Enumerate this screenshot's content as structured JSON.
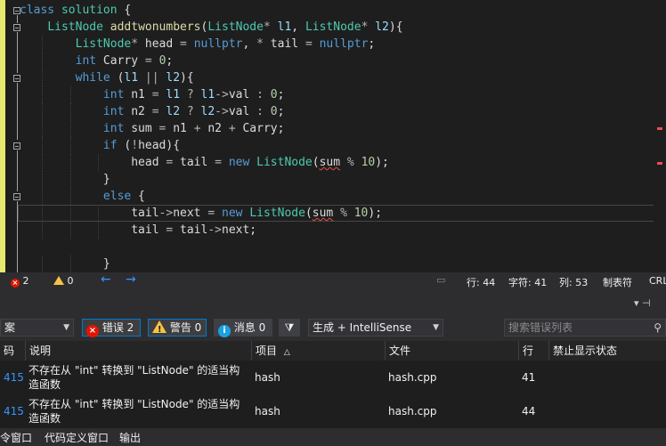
{
  "editor": {
    "lines": [
      [
        [
          "kw",
          "class"
        ],
        [
          "tx",
          " "
        ],
        [
          "ty",
          "solution"
        ],
        [
          "tx",
          " {"
        ]
      ],
      [
        [
          "tx",
          "    "
        ],
        [
          "ty",
          "ListNode"
        ],
        [
          "tx",
          " "
        ],
        [
          "fn",
          "addtwonumbers"
        ],
        [
          "tx",
          "("
        ],
        [
          "ty",
          "ListNode"
        ],
        [
          "op",
          "*"
        ],
        [
          "tx",
          " "
        ],
        [
          "pl",
          "l1"
        ],
        [
          "tx",
          ", "
        ],
        [
          "ty",
          "ListNode"
        ],
        [
          "op",
          "*"
        ],
        [
          "tx",
          " "
        ],
        [
          "pl",
          "l2"
        ],
        [
          "tx",
          "){"
        ]
      ],
      [
        [
          "tx",
          "        "
        ],
        [
          "ty",
          "ListNode"
        ],
        [
          "op",
          "*"
        ],
        [
          "tx",
          " head "
        ],
        [
          "op",
          "="
        ],
        [
          "tx",
          " "
        ],
        [
          "kw",
          "nullptr"
        ],
        [
          "tx",
          ", "
        ],
        [
          "op",
          "*"
        ],
        [
          "tx",
          " tail "
        ],
        [
          "op",
          "="
        ],
        [
          "tx",
          " "
        ],
        [
          "kw",
          "nullptr"
        ],
        [
          "tx",
          ";"
        ]
      ],
      [
        [
          "tx",
          "        "
        ],
        [
          "kw",
          "int"
        ],
        [
          "tx",
          " Carry "
        ],
        [
          "op",
          "="
        ],
        [
          "tx",
          " "
        ],
        [
          "nu",
          "0"
        ],
        [
          "tx",
          ";"
        ]
      ],
      [
        [
          "tx",
          "        "
        ],
        [
          "kw",
          "while"
        ],
        [
          "tx",
          " ("
        ],
        [
          "pl",
          "l1"
        ],
        [
          "tx",
          " "
        ],
        [
          "op",
          "||"
        ],
        [
          "tx",
          " "
        ],
        [
          "pl",
          "l2"
        ],
        [
          "tx",
          "){"
        ]
      ],
      [
        [
          "tx",
          "            "
        ],
        [
          "kw",
          "int"
        ],
        [
          "tx",
          " n1 "
        ],
        [
          "op",
          "="
        ],
        [
          "tx",
          " "
        ],
        [
          "pl",
          "l1"
        ],
        [
          "tx",
          " "
        ],
        [
          "op",
          "?"
        ],
        [
          "tx",
          " "
        ],
        [
          "pl",
          "l1"
        ],
        [
          "op",
          "->"
        ],
        [
          "tx",
          "val "
        ],
        [
          "op",
          ":"
        ],
        [
          "tx",
          " "
        ],
        [
          "nu",
          "0"
        ],
        [
          "tx",
          ";"
        ]
      ],
      [
        [
          "tx",
          "            "
        ],
        [
          "kw",
          "int"
        ],
        [
          "tx",
          " n2 "
        ],
        [
          "op",
          "="
        ],
        [
          "tx",
          " "
        ],
        [
          "pl",
          "l2"
        ],
        [
          "tx",
          " "
        ],
        [
          "op",
          "?"
        ],
        [
          "tx",
          " "
        ],
        [
          "pl",
          "l2"
        ],
        [
          "op",
          "->"
        ],
        [
          "tx",
          "val "
        ],
        [
          "op",
          ":"
        ],
        [
          "tx",
          " "
        ],
        [
          "nu",
          "0"
        ],
        [
          "tx",
          ";"
        ]
      ],
      [
        [
          "tx",
          "            "
        ],
        [
          "kw",
          "int"
        ],
        [
          "tx",
          " sum "
        ],
        [
          "op",
          "="
        ],
        [
          "tx",
          " n1 "
        ],
        [
          "op",
          "+"
        ],
        [
          "tx",
          " n2 "
        ],
        [
          "op",
          "+"
        ],
        [
          "tx",
          " Carry;"
        ]
      ],
      [
        [
          "tx",
          "            "
        ],
        [
          "kw",
          "if"
        ],
        [
          "tx",
          " ("
        ],
        [
          "op",
          "!"
        ],
        [
          "tx",
          "head){"
        ]
      ],
      [
        [
          "tx",
          "                head "
        ],
        [
          "op",
          "="
        ],
        [
          "tx",
          " tail "
        ],
        [
          "op",
          "="
        ],
        [
          "tx",
          " "
        ],
        [
          "kw",
          "new"
        ],
        [
          "tx",
          " "
        ],
        [
          "ty",
          "ListNode"
        ],
        [
          "tx",
          "("
        ],
        [
          "sq",
          "sum"
        ],
        [
          "tx",
          " "
        ],
        [
          "op",
          "%"
        ],
        [
          "tx",
          " "
        ],
        [
          "nu",
          "10"
        ],
        [
          "tx",
          ");"
        ]
      ],
      [
        [
          "tx",
          "            }"
        ]
      ],
      [
        [
          "tx",
          "            "
        ],
        [
          "kw",
          "else"
        ],
        [
          "tx",
          " {"
        ]
      ],
      [
        [
          "tx",
          "                tail"
        ],
        [
          "op",
          "->"
        ],
        [
          "tx",
          "next "
        ],
        [
          "op",
          "="
        ],
        [
          "tx",
          " "
        ],
        [
          "kw",
          "new"
        ],
        [
          "tx",
          " "
        ],
        [
          "ty",
          "ListNode"
        ],
        [
          "tx",
          "("
        ],
        [
          "sq",
          "sum"
        ],
        [
          "tx",
          " "
        ],
        [
          "op",
          "%"
        ],
        [
          "tx",
          " "
        ],
        [
          "nu",
          "10"
        ],
        [
          "tx",
          ");"
        ]
      ],
      [
        [
          "tx",
          "                tail "
        ],
        [
          "op",
          "="
        ],
        [
          "tx",
          " tail"
        ],
        [
          "op",
          "->"
        ],
        [
          "tx",
          "next;"
        ]
      ],
      [
        [
          "tx",
          ""
        ]
      ],
      [
        [
          "tx",
          "            }"
        ]
      ]
    ]
  },
  "status": {
    "errors": "2",
    "warnings": "0",
    "line": "行: 44",
    "col": "字符: 41",
    "colnum": "列: 53",
    "tabs": "制表符",
    "eol": "CRL"
  },
  "panel": {
    "title_left": "案",
    "pin": "▾  ⊣",
    "errors_btn": "错误 2",
    "warnings_btn": "警告 0",
    "messages_btn": "消息 0",
    "build_filter": "生成 + IntelliSense",
    "search_placeholder": "搜索错误列表"
  },
  "table": {
    "headers": {
      "code": "码",
      "desc": "说明",
      "project": "项目",
      "file": "文件",
      "line": "行",
      "suppress": "禁止显示状态"
    },
    "rows": [
      {
        "code": "415",
        "desc": "不存在从 \"int\" 转换到 \"ListNode\" 的适当构造函数",
        "project": "hash",
        "file": "hash.cpp",
        "line": "41"
      },
      {
        "code": "415",
        "desc": "不存在从 \"int\" 转换到 \"ListNode\" 的适当构造函数",
        "project": "hash",
        "file": "hash.cpp",
        "line": "44"
      }
    ]
  },
  "bottom_tabs": [
    "令窗口",
    "代码定义窗口",
    "输出"
  ],
  "colors": {
    "error": "#e51400",
    "warning": "#f6c344",
    "info": "#1ba1e2",
    "accent": "#007acc",
    "changebar": "#e8e86e"
  }
}
